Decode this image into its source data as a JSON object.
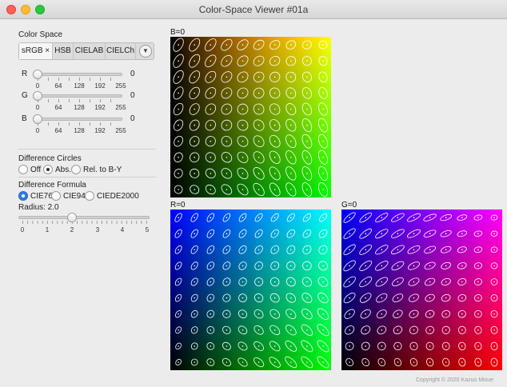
{
  "window": {
    "title": "Color-Space Viewer #01a"
  },
  "color_space": {
    "heading": "Color Space",
    "tabs": [
      {
        "label": "sRGB ×"
      },
      {
        "label": "HSB"
      },
      {
        "label": "CIELAB"
      },
      {
        "label": "CIELCh"
      }
    ],
    "sliders": [
      {
        "label": "R",
        "value": "0",
        "level": 0
      },
      {
        "label": "G",
        "value": "0",
        "level": 0
      },
      {
        "label": "B",
        "value": "0",
        "level": 0
      }
    ],
    "ticks": [
      "0",
      "64",
      "128",
      "192",
      "255"
    ]
  },
  "difference_circles": {
    "heading": "Difference Circles",
    "options": [
      "Off",
      "Abs.",
      "Rel. to B-Y"
    ],
    "selected": "Abs."
  },
  "difference_formula": {
    "heading": "Difference Formula",
    "options": [
      "CIE76",
      "CIE94",
      "CIEDE2000"
    ],
    "selected": "CIE76"
  },
  "radius": {
    "label": "Radius: 2.0",
    "value": 2.0,
    "min": 0,
    "max": 5,
    "ticks": [
      "0",
      "1",
      "2",
      "3",
      "4",
      "5"
    ]
  },
  "plots": [
    {
      "title": "B=0",
      "fixed": "B"
    },
    {
      "title": "R=0",
      "fixed": "R"
    },
    {
      "title": "G=0",
      "fixed": "G"
    }
  ],
  "footer": {
    "copyright": "Copyright © 2020 Kazuo Misue"
  },
  "colors": {
    "accent": "#2f7de1",
    "ellipse": "#ffffff"
  }
}
